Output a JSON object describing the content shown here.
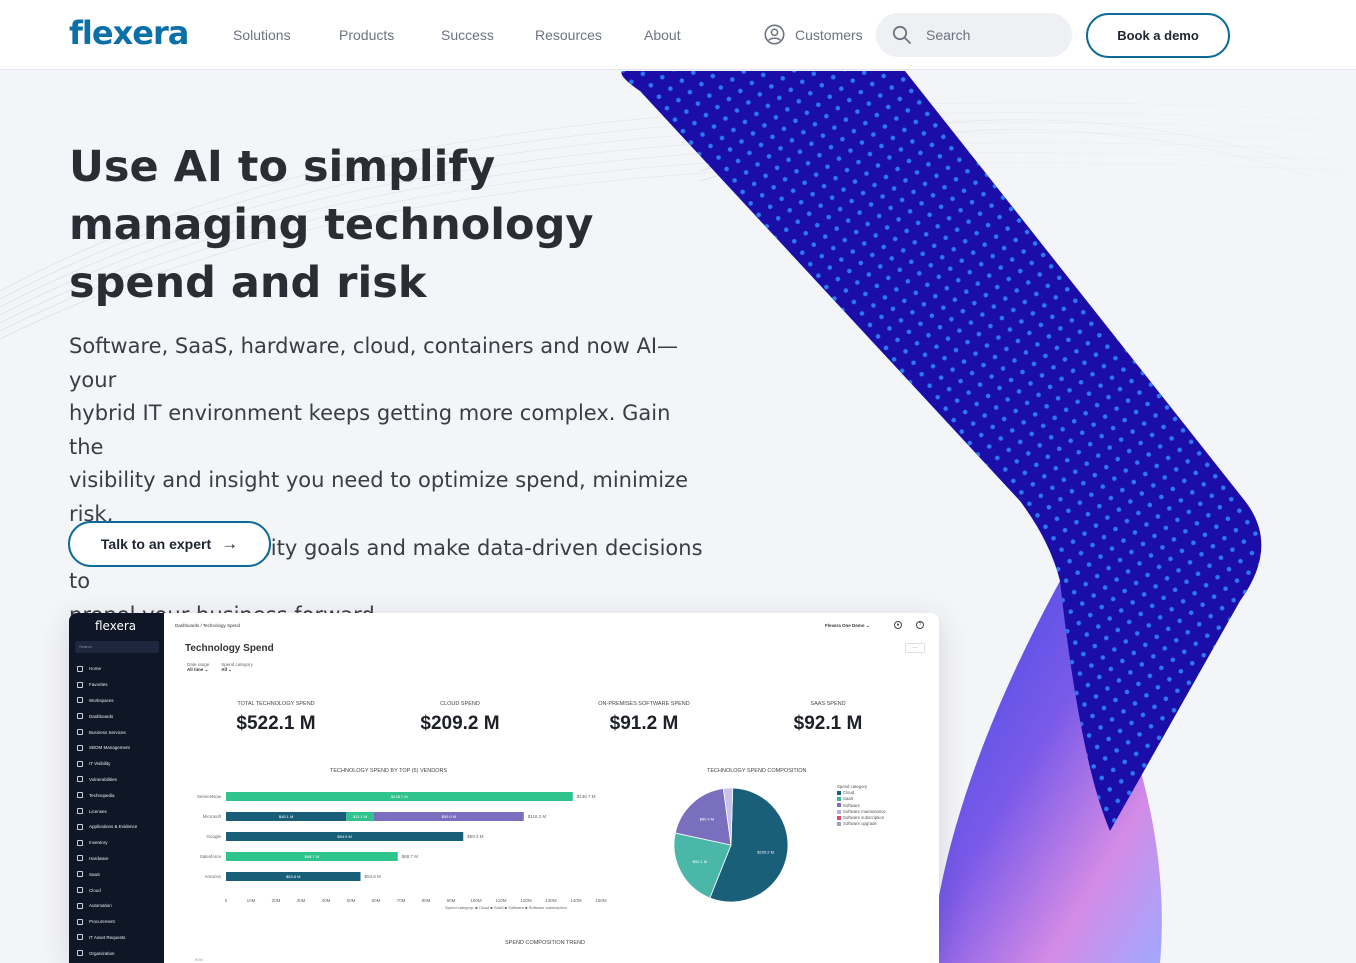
{
  "nav": {
    "logo": "flexera",
    "items": [
      "Solutions",
      "Products",
      "Success",
      "Resources",
      "About"
    ],
    "customers": "Customers",
    "search_placeholder": "Search",
    "cta": "Book a demo"
  },
  "hero": {
    "title_lines": [
      "Use AI to simplify",
      "managing technology",
      "spend and risk"
    ],
    "lead_lines": [
      "Software, SaaS, hardware, cloud, containers and now AI—your",
      "hybrid IT environment keeps getting more complex. Gain the",
      "visibility and insight you need to optimize spend, minimize risk,",
      "achieve sustainability goals and make data-driven decisions to",
      "propel your business forward."
    ],
    "cta": "Talk to an expert",
    "cta_arrow": "→"
  },
  "dashboard": {
    "logo": "flexera",
    "search": "Search",
    "sidebar": [
      "Home",
      "Favorites",
      "Workspaces",
      "Dashboards",
      "Business Services",
      "SBOM Management",
      "IT Visibility",
      "Vulnerabilities",
      "Technopedia",
      "Licenses",
      "Applications & Evidence",
      "Inventory",
      "Hardware",
      "SaaS",
      "Cloud",
      "Automation",
      "Procurement",
      "IT Asset Requests",
      "Organization"
    ],
    "breadcrumb": "Dashboards / Technology Spend",
    "org": "Flexera One Demo ⌄",
    "title": "Technology Spend",
    "filter_date_label": "Date range",
    "filter_date_value": "All time ⌄",
    "filter_cat_label": "Spend category",
    "filter_cat_value": "All ⌄",
    "more": "...",
    "kpis": [
      {
        "label": "TOTAL TECHNOLOGY SPEND",
        "value": "$522.1 M"
      },
      {
        "label": "CLOUD SPEND",
        "value": "$209.2 M"
      },
      {
        "label": "ON-PREMISES SOFTWARE SPEND",
        "value": "$91.2 M"
      },
      {
        "label": "SAAS SPEND",
        "value": "$92.1 M"
      }
    ],
    "bar_title": "TECHNOLOGY SPEND BY TOP (5) VENDORS",
    "pie_title": "TECHNOLOGY SPEND COMPOSITION",
    "trend_title": "SPEND COMPOSITION TREND",
    "trend_sub": "90M",
    "legend_title": "Spend category",
    "legend": [
      {
        "label": "Cloud",
        "color": "#1a5f7a"
      },
      {
        "label": "SaaS",
        "color": "#3bb59a"
      },
      {
        "label": "Software",
        "color": "#7a6fbf"
      },
      {
        "label": "Software maintenance",
        "color": "#b7b0e0"
      },
      {
        "label": "Software subscription",
        "color": "#d84a6a"
      },
      {
        "label": "Software upgrade",
        "color": "#9aa3b5"
      }
    ],
    "bar_legend": "Spend category: ■ Cloud ■ SaaS ■ Software ■ Software subscription"
  },
  "chart_data": [
    {
      "type": "bar",
      "title": "TECHNOLOGY SPEND BY TOP (5) VENDORS",
      "categories": [
        "ServiceNow",
        "Microsoft",
        "Google",
        "Salesforce",
        "Amazon"
      ],
      "xlim": [
        0,
        150
      ],
      "ticks": [
        "0",
        "10M",
        "20M",
        "30M",
        "40M",
        "50M",
        "60M",
        "70M",
        "80M",
        "90M",
        "100M",
        "110M",
        "120M",
        "130M",
        "140M",
        "150M"
      ],
      "series": [
        {
          "name": "Cloud",
          "values": [
            0,
            48.1,
            94.9,
            0,
            53.8
          ],
          "labels": [
            "",
            "$48.1 M",
            "$94.9 M",
            "",
            "$53.8 M"
          ],
          "color": "#1a5f7a"
        },
        {
          "name": "SaaS",
          "values": [
            138.7,
            11.1,
            0,
            68.7,
            0
          ],
          "labels": [
            "$138.7 M",
            "$11.1 M",
            "",
            "$68.7 M",
            ""
          ],
          "color": "#2fc48d"
        },
        {
          "name": "Software",
          "values": [
            0,
            59.9,
            0,
            0,
            0
          ],
          "labels": [
            "",
            "$59.9 M",
            "",
            "",
            ""
          ],
          "color": "#7a6fbf"
        }
      ],
      "totals": [
        "$138.7 M",
        "$118.2 M",
        "$99.3 M",
        "$68.7 M",
        "$53.8 M"
      ]
    },
    {
      "type": "pie",
      "title": "TECHNOLOGY SPEND COMPOSITION",
      "slices": [
        {
          "label": "Cloud",
          "value": 229.2,
          "text": "$229.2 M",
          "color": "#1a5f7a"
        },
        {
          "label": "SaaS",
          "value": 92.1,
          "text": "$92.1 M",
          "color": "#4bb7a8"
        },
        {
          "label": "Software",
          "value": 80.4,
          "text": "$80.4 M",
          "color": "#7a6fbf"
        },
        {
          "label": "Software maintenance",
          "value": 10.8,
          "text": "",
          "color": "#c8c2ea"
        }
      ]
    }
  ]
}
